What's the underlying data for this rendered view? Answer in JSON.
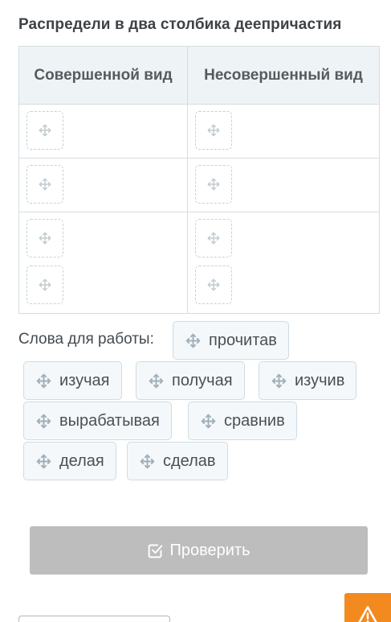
{
  "task": {
    "title": "Распредели в два столбика деепричастия"
  },
  "table": {
    "headers": [
      "Совершенной вид",
      "Несовершенный вид"
    ],
    "slot_icon": "move-cross-icon"
  },
  "words": {
    "label": "Слова для работы:",
    "chip_icon": "move-cross-icon",
    "items": [
      "прочитав",
      "изучая",
      "получая",
      "изучив",
      "вырабатывая",
      "сравнив",
      "делая",
      "сделав"
    ]
  },
  "actions": {
    "check_label": "Проверить",
    "check_icon": "checkbox-check-icon",
    "help_icon": "warning-triangle-icon"
  },
  "colors": {
    "title": "#3d4246",
    "table_header_bg": "#eef3f5",
    "chip_bg": "#f4f8fa",
    "chip_border": "#cfdce3",
    "check_button_bg": "#bdbdbd",
    "orange_accent": "#f28a1f"
  }
}
